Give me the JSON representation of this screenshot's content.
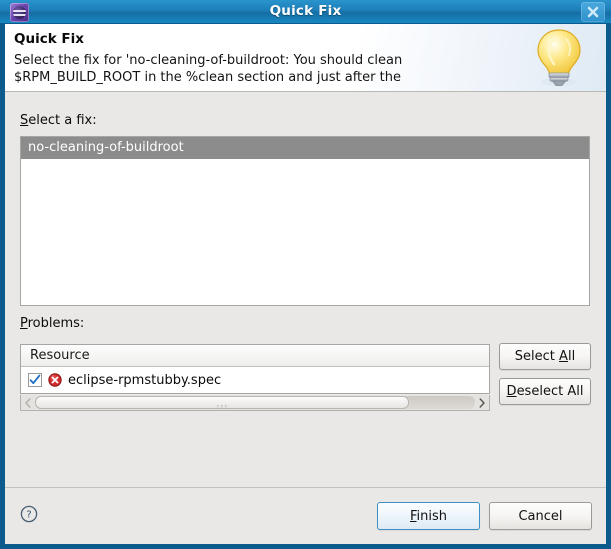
{
  "window": {
    "title": "Quick Fix",
    "app_icon": "eclipse-icon",
    "close_icon": "close-icon"
  },
  "header": {
    "title": "Quick Fix",
    "message": "Select the fix for 'no-cleaning-of-buildroot: You should clean\n$RPM_BUILD_ROOT in the %clean section and just after the",
    "illustration": "lightbulb-icon"
  },
  "fix_section": {
    "label_prefix": "S",
    "label_rest": "elect a fix:",
    "items": [
      {
        "label": "no-cleaning-of-buildroot",
        "selected": true
      }
    ]
  },
  "problems_section": {
    "label_prefix": "P",
    "label_rest": "roblems:",
    "columns": [
      "Resource"
    ],
    "rows": [
      {
        "checked": true,
        "status_icon": "error-icon",
        "resource": "eclipse-rpmstubby.spec"
      }
    ],
    "buttons": {
      "select_all": {
        "before": "Select ",
        "mnemonic": "A",
        "after": "ll"
      },
      "deselect_all": {
        "before": "",
        "mnemonic": "D",
        "after": "eselect All"
      }
    },
    "scrollbar": {
      "left_arrow": "chevron-left-icon",
      "right_arrow": "chevron-right-icon",
      "grip": "grip-dots-icon"
    }
  },
  "footer": {
    "help_icon": "help-icon",
    "finish": {
      "before": "",
      "mnemonic": "F",
      "after": "inish"
    },
    "cancel": {
      "before": "Cancel",
      "mnemonic": "",
      "after": ""
    }
  },
  "colors": {
    "window_border": "#0d5b8c",
    "titlebar": "#1d7eb8",
    "dialog_bg": "#e9e8e6",
    "selection_gray": "#8c8c8c",
    "error_red": "#cf2a2a",
    "default_button_border": "#3e8fc4"
  }
}
